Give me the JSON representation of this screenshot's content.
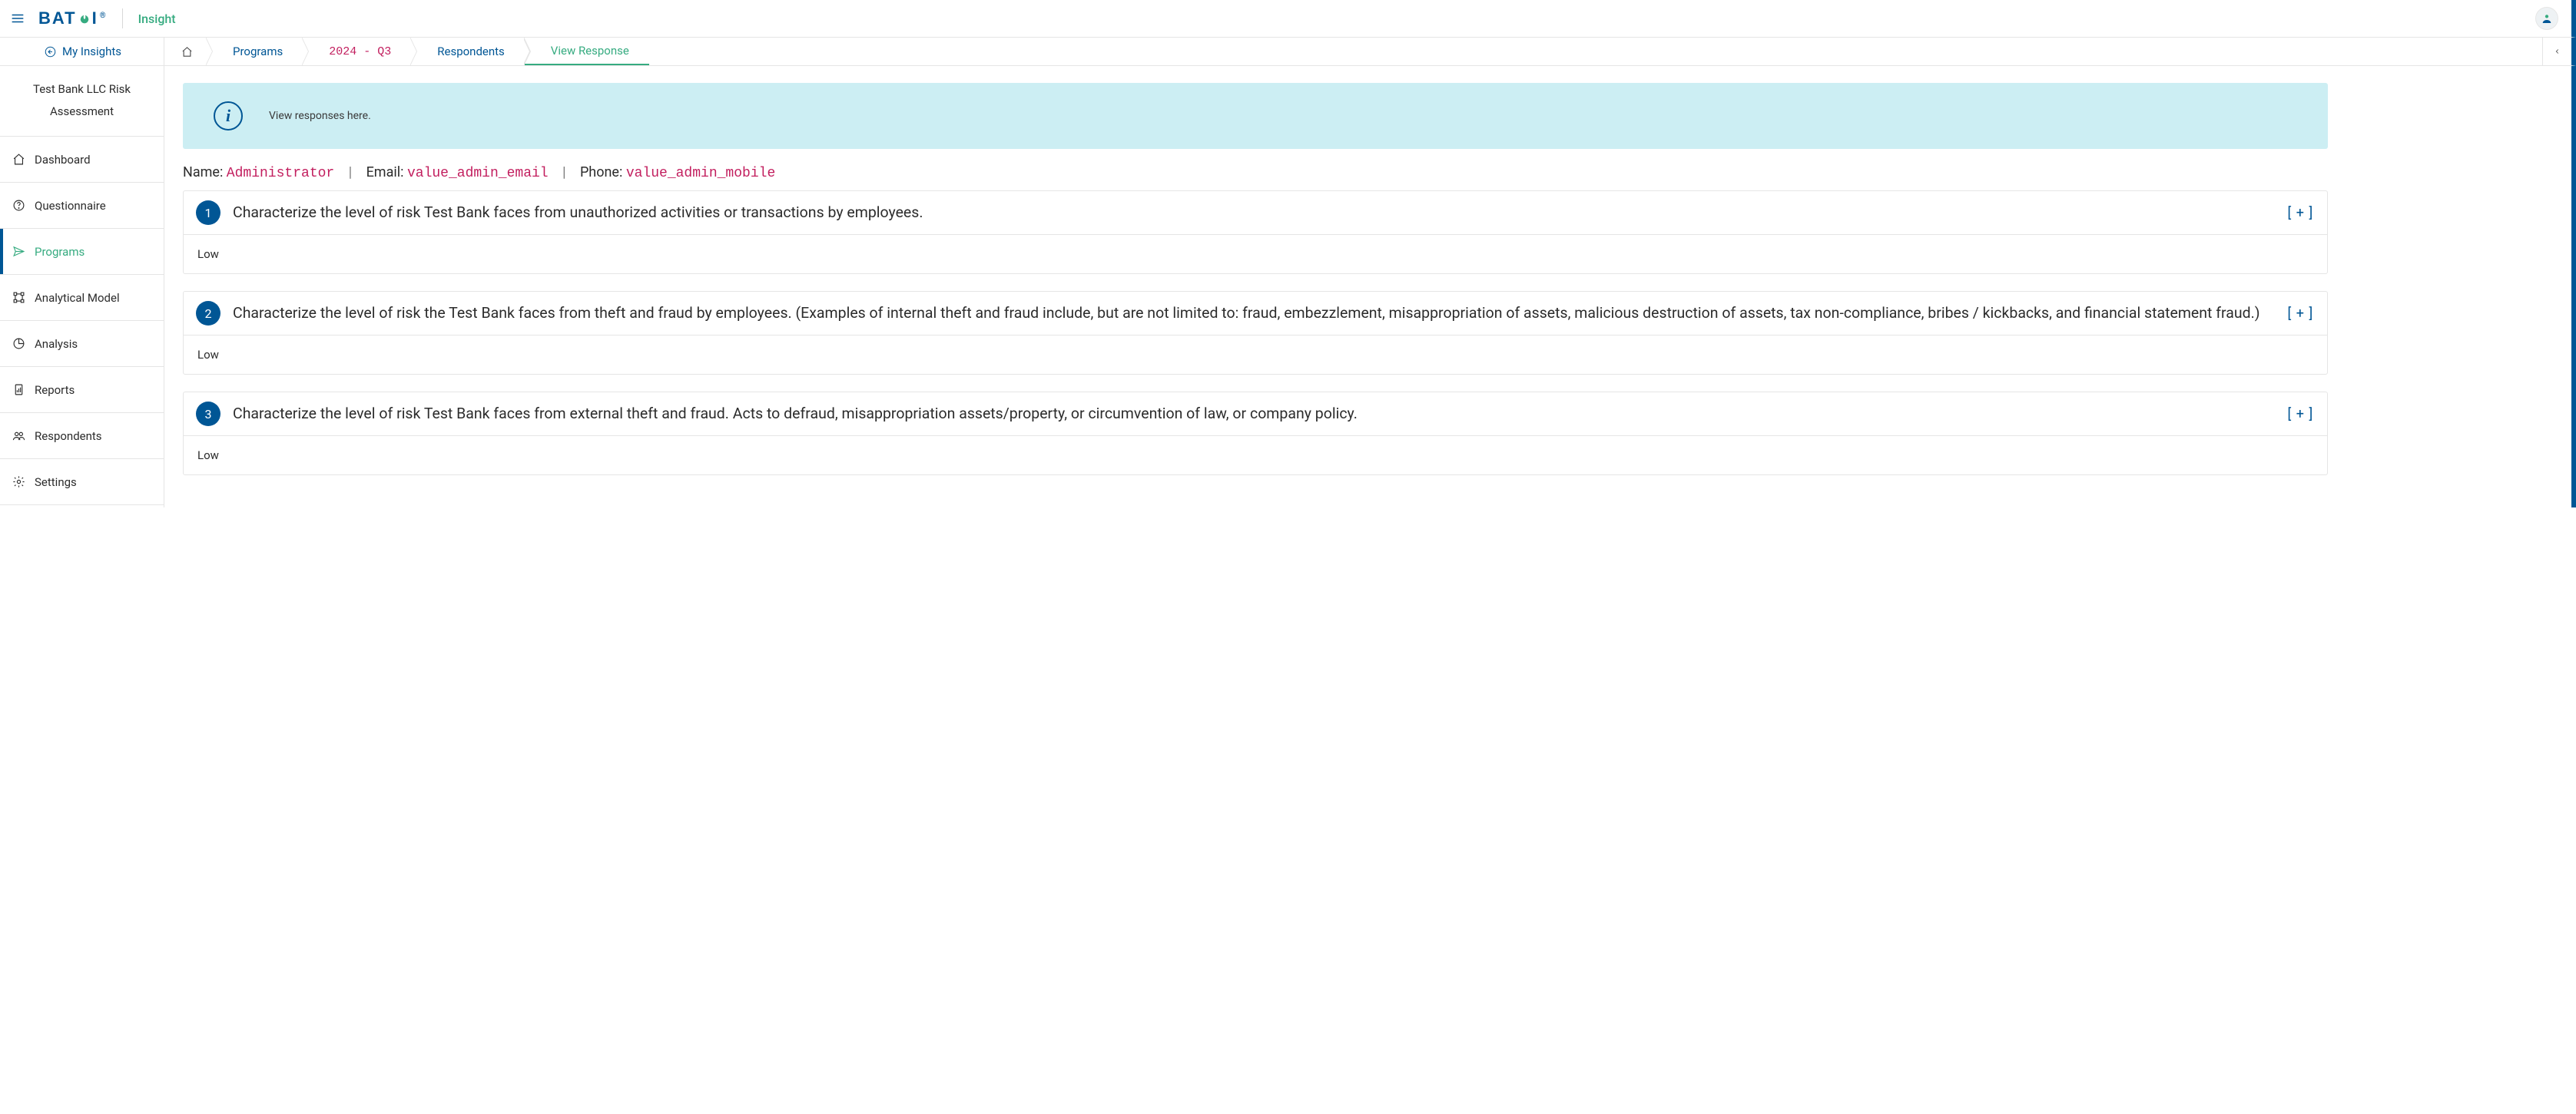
{
  "brand": {
    "name_part1": "BAT",
    "name_part2": "I",
    "registered": "®",
    "product": "Insight"
  },
  "header": {
    "my_insights": "My Insights"
  },
  "breadcrumb": {
    "programs": "Programs",
    "period": "2024 - Q3",
    "respondents": "Respondents",
    "view_response": "View Response"
  },
  "sidebar": {
    "title": "Test Bank LLC Risk Assessment",
    "items": [
      {
        "key": "dashboard",
        "label": "Dashboard"
      },
      {
        "key": "questionnaire",
        "label": "Questionnaire"
      },
      {
        "key": "programs",
        "label": "Programs"
      },
      {
        "key": "analytical-model",
        "label": "Analytical Model"
      },
      {
        "key": "analysis",
        "label": "Analysis"
      },
      {
        "key": "reports",
        "label": "Reports"
      },
      {
        "key": "respondents",
        "label": "Respondents"
      },
      {
        "key": "settings",
        "label": "Settings"
      }
    ]
  },
  "banner": {
    "text": "View responses here."
  },
  "respondent": {
    "name_label": "Name:",
    "name_value": "Administrator",
    "email_label": "Email:",
    "email_value": "value_admin_email",
    "phone_label": "Phone:",
    "phone_value": "value_admin_mobile"
  },
  "questions": [
    {
      "num": "1",
      "text": "Characterize the level of risk Test Bank faces from unauthorized activities or transactions by employees.",
      "answer": "Low",
      "toggle": "[ + ]"
    },
    {
      "num": "2",
      "text": "Characterize the level of risk the Test Bank faces from theft and fraud by employees. (Examples of internal theft and fraud include, but are not limited to: fraud, embezzlement, misappropriation of assets, malicious destruction of assets, tax non-compliance, bribes / kickbacks, and financial statement fraud.)",
      "answer": "Low",
      "toggle": "[ + ]"
    },
    {
      "num": "3",
      "text": "Characterize the level of risk Test Bank faces from external theft and fraud. Acts to defraud, misappropriation assets/property, or circumvention of law, or company policy.",
      "answer": "Low",
      "toggle": "[ + ]"
    }
  ]
}
